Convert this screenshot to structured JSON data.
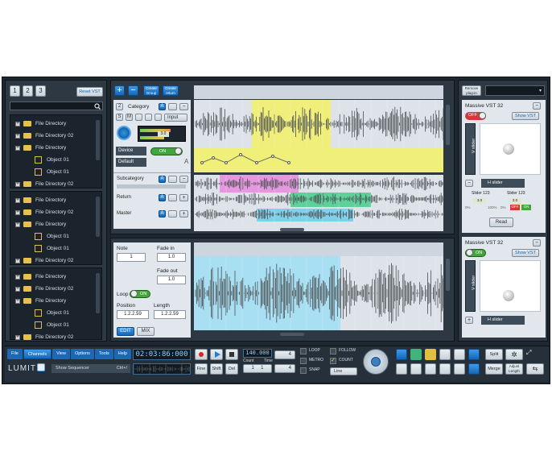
{
  "left_panel": {
    "tabs": [
      "1",
      "2",
      "3"
    ],
    "reset_vst": "Reset VST",
    "tree1": [
      {
        "t": "folder",
        "label": "File Directory"
      },
      {
        "t": "folder",
        "label": "File Directory 02"
      },
      {
        "t": "folder",
        "label": "File Directory"
      },
      {
        "t": "obj",
        "label": "Object 01"
      },
      {
        "t": "obj",
        "label": "Object 01"
      },
      {
        "t": "folder",
        "label": "File Directory 02"
      }
    ],
    "tree2": [
      {
        "t": "folder",
        "label": "File Directory"
      },
      {
        "t": "folder",
        "label": "File Directory 02"
      },
      {
        "t": "folder",
        "label": "File Directory"
      },
      {
        "t": "obj",
        "label": "Object 01"
      },
      {
        "t": "obj",
        "label": "Object 01"
      },
      {
        "t": "folder",
        "label": "File Directory 02"
      }
    ],
    "tree3": [
      {
        "t": "folder",
        "label": "File Directory"
      },
      {
        "t": "folder",
        "label": "File Directory 02"
      },
      {
        "t": "folder",
        "label": "File Directory"
      },
      {
        "t": "obj",
        "label": "Object 01"
      },
      {
        "t": "obj",
        "label": "Object 01"
      },
      {
        "t": "folder",
        "label": "File Directory 02"
      }
    ]
  },
  "track_toolbar": {
    "plus": "+",
    "minus": "−",
    "create_group": "Create Group",
    "create_return": "Create return"
  },
  "track_panel": {
    "category": "Category",
    "a": "A",
    "input": "Input",
    "device": "Device",
    "on": "ON",
    "default": "Default",
    "s": "S",
    "m": "M",
    "lcd": "3.0",
    "subcategory": "Subcategory",
    "return": "Return",
    "master": "Master"
  },
  "note_panel": {
    "note": "Note",
    "note_val": "1",
    "fade_in": "Fade in",
    "fade_in_val": "1.0",
    "fade_out": "Fade out",
    "fade_out_val": "1.0",
    "loop": "Loop",
    "on": "ON",
    "position": "Position",
    "length": "Length",
    "position_val": "1.2.2.59",
    "length_val": "1.2.2.59",
    "edit": "EDIT",
    "mix": "MIX"
  },
  "right_panel": {
    "remove_plugin": "Remove plug-in",
    "vst1": {
      "title": "Massive VST 32",
      "off": "OFF",
      "show": "Show VST",
      "v_slider": "V slider",
      "h_slider": "H slider",
      "slider1": "Slider 123",
      "slider2": "Slider 123",
      "lcd1": "3.0",
      "lcd2": "3.0",
      "pct1a": "0%",
      "pct1b": "100%",
      "pct2a": "0%",
      "pct2b": "100%",
      "off2": "OFF",
      "on2": "ON",
      "read": "Read"
    },
    "vst2": {
      "title": "Massive VST 32",
      "on": "ON",
      "show": "Show VST",
      "v_slider": "V slider",
      "h_slider": "H slider"
    }
  },
  "bottom": {
    "menu": [
      "File",
      "Channels",
      "View",
      "Options",
      "Tools",
      "Help"
    ],
    "logo": "LUMIT",
    "show_sequencer": "Show Sequencer",
    "shortcut": "Ctrl+/",
    "time": "02:03:86:000",
    "fine": "Fine",
    "shift": "Shift",
    "del": "Del",
    "count_display": "140.000",
    "count_label": "Count",
    "time_label": "Time",
    "count_val": "1",
    "time_val": "1",
    "four_a": "4",
    "four_b": "4",
    "loop": "LOOP",
    "metro": "METRO",
    "snap": "SNAP",
    "follow": "FOLLOW",
    "count": "COUNT",
    "line": "Line",
    "split": "Split",
    "merge": "Merge",
    "adjust": "Adjust Length"
  }
}
